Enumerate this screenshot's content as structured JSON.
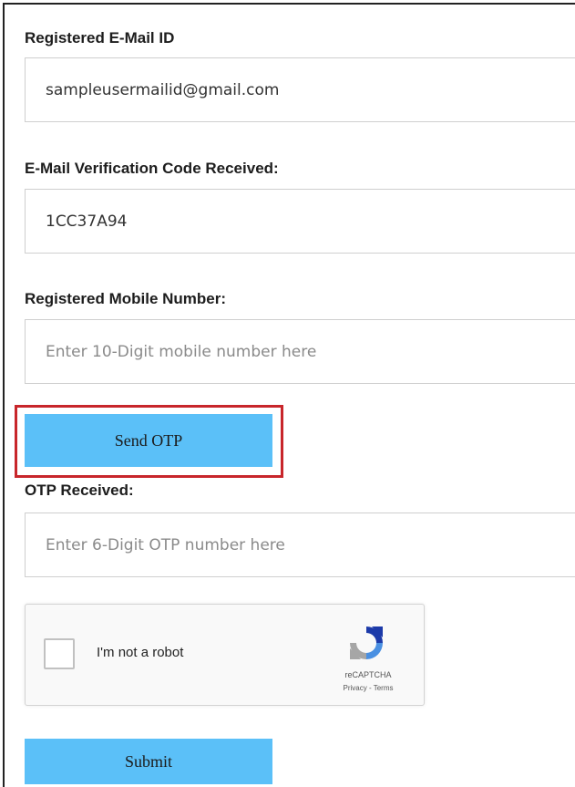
{
  "form": {
    "email_label": "Registered E-Mail ID",
    "email_value": "sampleusermailid@gmail.com",
    "code_label": "E-Mail Verification Code Received:",
    "code_value": "1CC37A94",
    "mobile_label": "Registered Mobile Number:",
    "mobile_placeholder": "Enter 10-Digit mobile number here",
    "send_otp_label": "Send OTP",
    "otp_label": "OTP Received:",
    "otp_placeholder": "Enter 6-Digit OTP number here",
    "submit_label": "Submit"
  },
  "captcha": {
    "checkbox_label": "I'm not a robot",
    "brand": "reCAPTCHA",
    "links": "Privacy - Terms"
  },
  "colors": {
    "button_bg": "#5bc0f8",
    "highlight_border": "#c8262b"
  }
}
